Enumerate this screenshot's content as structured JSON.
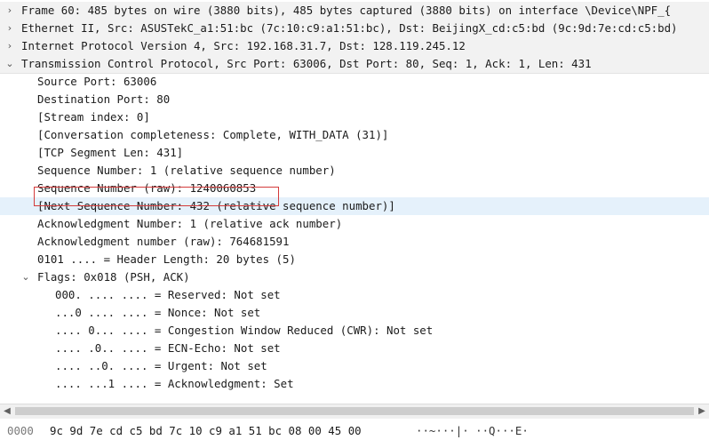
{
  "tree": [
    {
      "arrow": "›",
      "text": "Frame 60: 485 bytes on wire (3880 bits), 485 bytes captured (3880 bits) on interface \\Device\\NPF_{",
      "kind": "section"
    },
    {
      "arrow": "›",
      "text": "Ethernet II, Src: ASUSTekC_a1:51:bc (7c:10:c9:a1:51:bc), Dst: BeijingX_cd:c5:bd (9c:9d:7e:cd:c5:bd)",
      "kind": "section"
    },
    {
      "arrow": "›",
      "text": "Internet Protocol Version 4, Src: 192.168.31.7, Dst: 128.119.245.12",
      "kind": "section"
    },
    {
      "arrow": "⌄",
      "text": "Transmission Control Protocol, Src Port: 63006, Dst Port: 80, Seq: 1, Ack: 1, Len: 431",
      "kind": "section"
    },
    {
      "text": "Source Port: 63006"
    },
    {
      "text": "Destination Port: 80"
    },
    {
      "text": "[Stream index: 0]"
    },
    {
      "text": "[Conversation completeness: Complete, WITH_DATA (31)]"
    },
    {
      "text": "[TCP Segment Len: 431]"
    },
    {
      "text": "Sequence Number: 1    (relative sequence number)"
    },
    {
      "text": "Sequence Number (raw): 1240060853"
    },
    {
      "text": "[Next Sequence Number: 432    (relative sequence number)]",
      "kind": "highlight"
    },
    {
      "text": "Acknowledgment Number: 1    (relative ack number)"
    },
    {
      "text": "Acknowledgment number (raw): 764681591"
    },
    {
      "text": "0101 .... = Header Length: 20 bytes (5)"
    },
    {
      "arrow": "⌄",
      "text": "Flags: 0x018 (PSH, ACK)",
      "sub": true
    },
    {
      "text": "000. .... .... = Reserved: Not set",
      "deep": true
    },
    {
      "text": "...0 .... .... = Nonce: Not set",
      "deep": true
    },
    {
      "text": ".... 0... .... = Congestion Window Reduced (CWR): Not set",
      "deep": true
    },
    {
      "text": ".... .0.. .... = ECN-Echo: Not set",
      "deep": true
    },
    {
      "text": ".... ..0. .... = Urgent: Not set",
      "deep": true
    },
    {
      "text": ".... ...1 .... = Acknowledgment: Set",
      "deep": true
    }
  ],
  "bytes_pane": {
    "offset": "0000",
    "hex": "9c 9d 7e cd c5 bd 7c 10  c9 a1 51 bc 08 00 45 00",
    "ascii": "··~···|·  ··Q···E·"
  },
  "scrollbar": {
    "left_icon": "scroll-left-icon",
    "right_icon": "scroll-right-icon"
  }
}
